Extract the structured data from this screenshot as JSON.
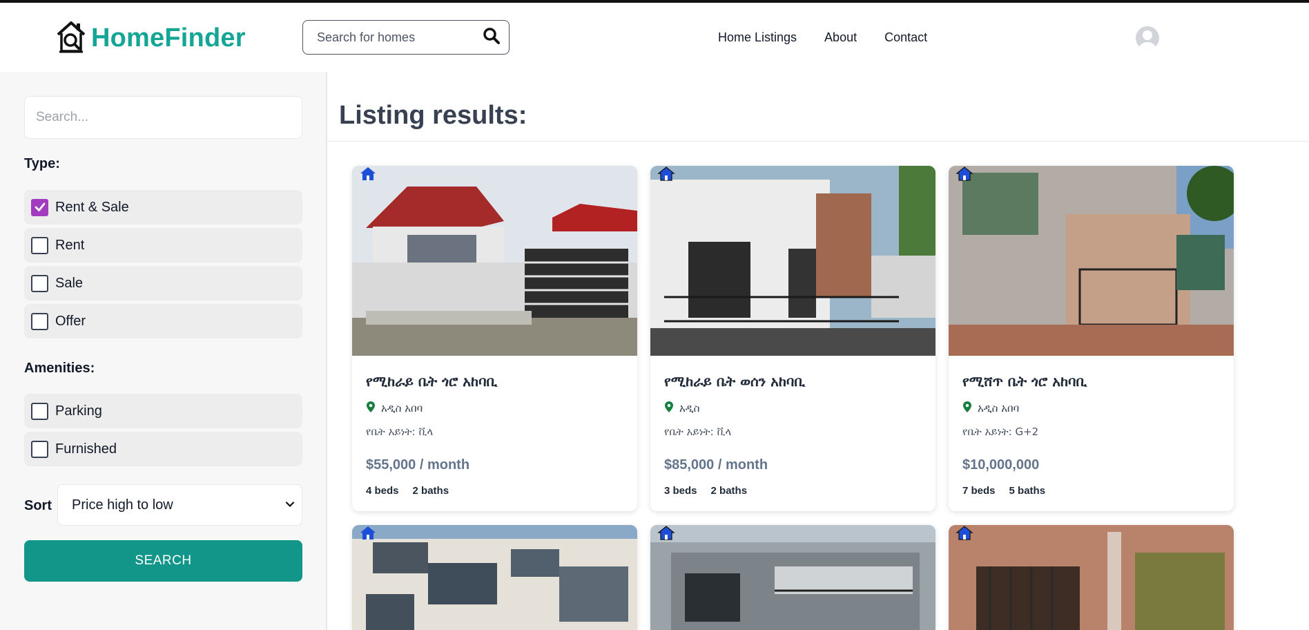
{
  "header": {
    "brand": "HomeFinder",
    "search_placeholder": "Search for homes",
    "nav": [
      "Home Listings",
      "About",
      "Contact"
    ]
  },
  "sidebar": {
    "search_placeholder": "Search...",
    "type_title": "Type:",
    "types": [
      {
        "label": "Rent & Sale",
        "checked": true
      },
      {
        "label": "Rent",
        "checked": false
      },
      {
        "label": "Sale",
        "checked": false
      },
      {
        "label": "Offer",
        "checked": false
      }
    ],
    "amenities_title": "Amenities:",
    "amenities": [
      {
        "label": "Parking",
        "checked": false
      },
      {
        "label": "Furnished",
        "checked": false
      }
    ],
    "sort_label": "Sort",
    "sort_value": "Price high to low",
    "search_button": "SEARCH"
  },
  "main": {
    "title": "Listing results:",
    "listings": [
      {
        "title": "የሚከራይ ቤት ጎሮ አከባቢ",
        "location": "አዲስ አበባ",
        "type": "የቤት አይነት: ቪላ",
        "price": "$55,000 / month",
        "beds": "4 beds",
        "baths": "2 baths"
      },
      {
        "title": "የሚከራይ ቤት ወሰን አከባቢ",
        "location": "አዲስ",
        "type": "የቤት አይነት: ቪላ",
        "price": "$85,000 / month",
        "beds": "3 beds",
        "baths": "2 baths"
      },
      {
        "title": "የሚሸጥ ቤት ጎሮ አከባቢ",
        "location": "አዲስ አበባ",
        "type": "የቤት አይነት: G+2",
        "price": "$10,000,000",
        "beds": "7 beds",
        "baths": "5 baths"
      }
    ]
  },
  "colors": {
    "brand": "#14a595",
    "search_button": "#13968a",
    "checkbox_checked": "#a23bbf",
    "price": "#64748b",
    "location_pin": "#15803d"
  },
  "icons": {
    "logo": "house-magnifier-icon",
    "search": "search-icon",
    "avatar": "user-avatar-icon",
    "location": "map-pin-icon",
    "badge": "house-badge-icon",
    "dropdown": "chevron-down-icon"
  }
}
